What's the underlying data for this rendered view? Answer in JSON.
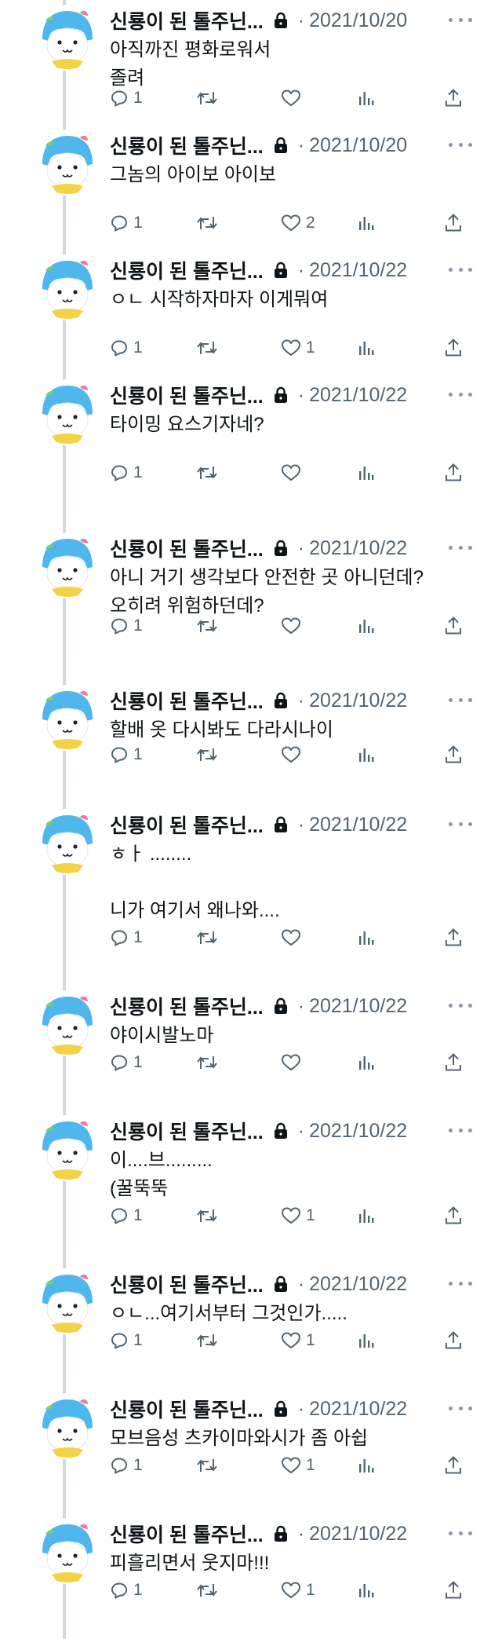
{
  "author": {
    "display_name": "신룡이 된 톨주닌...",
    "separator": "·"
  },
  "tweets": [
    {
      "date": "2021/10/20",
      "text": "아직까진 평화로워서\n졸려",
      "replies": "1",
      "retweets": "",
      "likes": ""
    },
    {
      "date": "2021/10/20",
      "text": "그놈의 아이보 아이보",
      "replies": "1",
      "retweets": "",
      "likes": "2"
    },
    {
      "date": "2021/10/22",
      "text": "ㅇㄴ 시작하자마자 이게뭐여",
      "replies": "1",
      "retweets": "",
      "likes": "1"
    },
    {
      "date": "2021/10/22",
      "text": "타이밍 요스기자네?",
      "replies": "1",
      "retweets": "",
      "likes": ""
    },
    {
      "date": "2021/10/22",
      "text": "아니 거기 생각보다 안전한 곳 아니던데?\n오히려 위험하던데?",
      "replies": "1",
      "retweets": "",
      "likes": ""
    },
    {
      "date": "2021/10/22",
      "text": "할배 옷 다시봐도 다라시나이",
      "replies": "1",
      "retweets": "",
      "likes": ""
    },
    {
      "date": "2021/10/22",
      "text": "ㅎㅏ ........\n\n니가 여기서 왜나와....",
      "replies": "1",
      "retweets": "",
      "likes": ""
    },
    {
      "date": "2021/10/22",
      "text": "야이시발노마",
      "replies": "1",
      "retweets": "",
      "likes": ""
    },
    {
      "date": "2021/10/22",
      "text": "이....브.........\n(꿀뚝뚝",
      "replies": "1",
      "retweets": "",
      "likes": "1"
    },
    {
      "date": "2021/10/22",
      "text": "ㅇㄴ...여기서부터 그것인가.....",
      "replies": "1",
      "retweets": "",
      "likes": "1"
    },
    {
      "date": "2021/10/22",
      "text": "모브음성 츠카이마와시가 좀 아쉽",
      "replies": "1",
      "retweets": "",
      "likes": "1"
    },
    {
      "date": "2021/10/22",
      "text": "피흘리면서 웃지마!!!",
      "replies": "1",
      "retweets": "",
      "likes": "1"
    }
  ],
  "colors": {
    "text": "#0f1419",
    "secondary": "#536471",
    "rail": "#cfd9de",
    "avatar_blue": "#4fb7ec",
    "avatar_yellow": "#f2d347"
  },
  "icons": [
    "reply-icon",
    "retweet-icon",
    "like-icon",
    "analytics-icon",
    "share-icon",
    "lock-icon",
    "more-icon"
  ]
}
